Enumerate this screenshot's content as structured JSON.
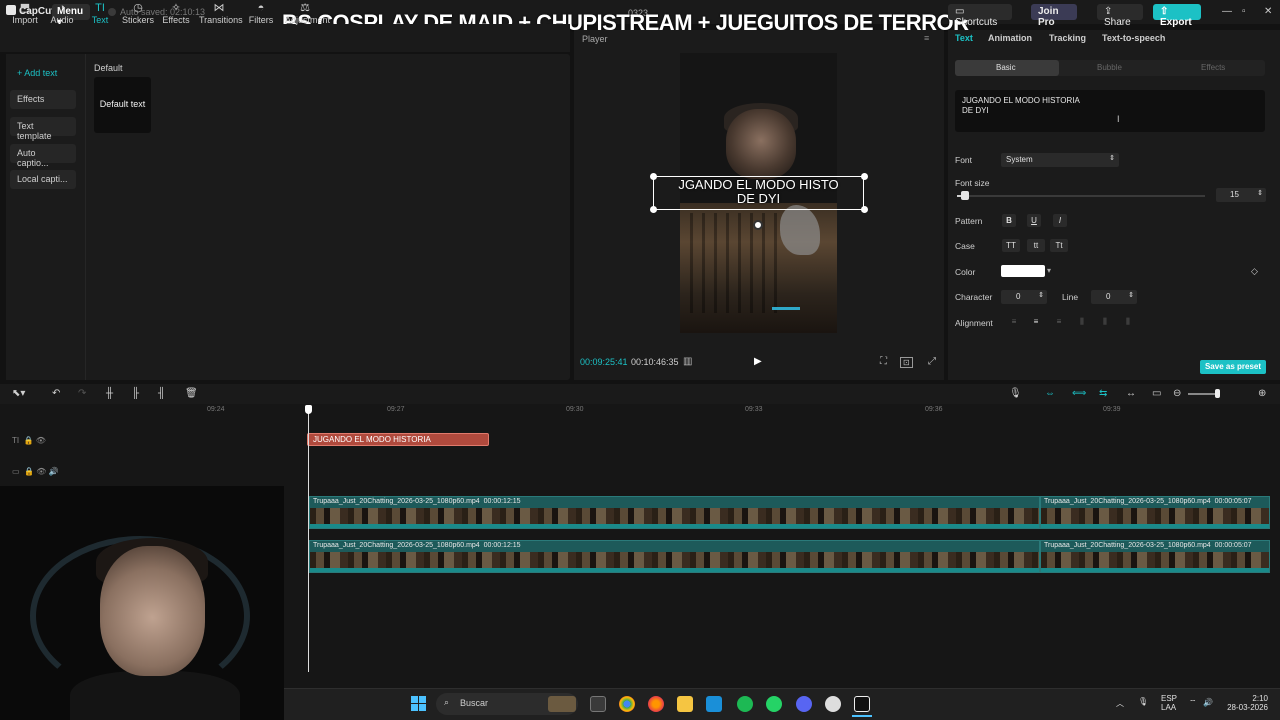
{
  "app": {
    "logo_label": "CapCut",
    "menu_label": "Menu",
    "autosave": "Auto saved: 02:10:13",
    "project_name": "0323",
    "stream_banner": "BS COSPLAY DE MAID + CHUPISTREAM + JUEGUITOS DE TERROR",
    "shortcuts_label": "Shortcuts",
    "join_pro_label": "Join Pro",
    "share_label": "Share",
    "export_label": "Export"
  },
  "tools": [
    {
      "label": "Import",
      "icon": "import-icon"
    },
    {
      "label": "Audio",
      "icon": "audio-icon"
    },
    {
      "label": "Text",
      "icon": "text-icon"
    },
    {
      "label": "Stickers",
      "icon": "stickers-icon"
    },
    {
      "label": "Effects",
      "icon": "effects-icon"
    },
    {
      "label": "Transitions",
      "icon": "transitions-icon"
    },
    {
      "label": "Filters",
      "icon": "filters-icon"
    },
    {
      "label": "Adjustment",
      "icon": "adjustment-icon"
    }
  ],
  "left_nav": [
    {
      "label": "+ Add text"
    },
    {
      "label": "Effects"
    },
    {
      "label": "Text template"
    },
    {
      "label": "Auto captio..."
    },
    {
      "label": "Local capti..."
    }
  ],
  "text_library": {
    "section_label": "Default",
    "card_label": "Default text"
  },
  "player": {
    "title": "Player",
    "overlay_text": "JUGANDO EL MODO HISTORIA\nDE DYI",
    "overlay_visible": "JGANDO EL MODO HISTO\nDE DYI",
    "current_time": "00:09:25:41",
    "duration": "00:10:46:35",
    "ratio_label": "Ratio"
  },
  "inspector": {
    "tabs": [
      "Text",
      "Animation",
      "Tracking",
      "Text-to-speech"
    ],
    "subtabs": [
      "Basic",
      "Bubble",
      "Effects"
    ],
    "text_value": "JUGANDO EL MODO HISTORIA\nDE DYI",
    "font_label": "Font",
    "font_value": "System",
    "font_size_label": "Font size",
    "font_size_value": "15",
    "pattern_label": "Pattern",
    "pattern_buttons": [
      "B",
      "U",
      "I"
    ],
    "case_label": "Case",
    "case_buttons": [
      "TT",
      "tt",
      "Tt"
    ],
    "color_label": "Color",
    "color_value": "#ffffff",
    "character_label": "Character",
    "character_value": "0",
    "line_label": "Line",
    "line_value": "0",
    "alignment_label": "Alignment",
    "save_preset_label": "Save as preset",
    "accent_color": "#1cc1c5"
  },
  "timeline": {
    "ruler": [
      "09:24",
      "09:27",
      "09:30",
      "09:33",
      "09:36",
      "09:39"
    ],
    "text_clip_label": "JUGANDO EL MODO HISTORIA",
    "video_clips": [
      {
        "name": "Trupaaa_Just_20Chatting_2026-03-25_1080p60.mp4",
        "duration": "00:00:12:15"
      },
      {
        "name": "Trupaaa_Just_20Chatting_2026-03-25_1080p60.mp4",
        "duration": "00:00:05:07"
      },
      {
        "name": "Trupaaa_Just_20Chatting_2026-03-25_1080p60.mp4",
        "duration": "00:00:12:15"
      },
      {
        "name": "Trupaaa_Just_20Chatting_2026-03-25_1080p60.mp4",
        "duration": "00:00:05:07"
      }
    ]
  },
  "taskbar": {
    "search_placeholder": "Buscar",
    "lang_top": "ESP",
    "lang_bottom": "LAA",
    "time": "2:10",
    "date": "28-03-2026"
  }
}
